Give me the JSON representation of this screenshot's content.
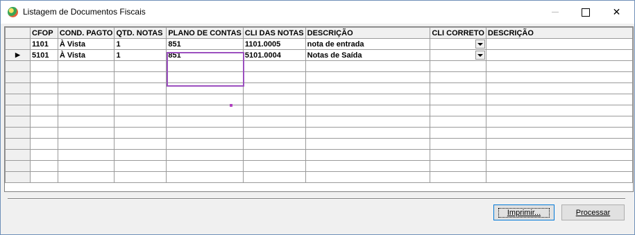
{
  "window": {
    "title": "Listagem de Documentos Fiscais"
  },
  "grid": {
    "columns": [
      "CFOP",
      "COND. PAGTO",
      "QTD. NOTAS",
      "PLANO DE CONTAS",
      "CLI DAS NOTAS",
      "DESCRIÇÃO",
      "CLI CORRETO",
      "DESCRIÇÃO"
    ],
    "rows": [
      [
        "1101",
        "À Vista",
        "1",
        "851",
        "1101.0005",
        "nota de entrada",
        "",
        ""
      ],
      [
        "5101",
        "À Vista",
        "1",
        "851",
        "5101.0004",
        "Notas de Saída",
        "",
        ""
      ]
    ],
    "current_row_indicator": "▶"
  },
  "buttons": {
    "print": "Imprimir...",
    "process": "Processar"
  }
}
